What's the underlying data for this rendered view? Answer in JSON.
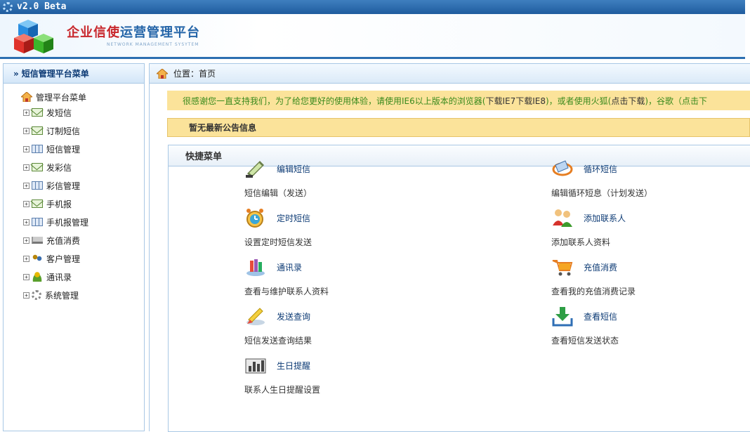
{
  "topbar": {
    "version": "v2.0 Beta"
  },
  "header": {
    "title_red": "企业信使",
    "title_blue": "运营管理平台",
    "subtitle": "NETWORK MANAGEMENT SYSYTEM"
  },
  "sidebar": {
    "heading": "短信管理平台菜单",
    "root": "管理平台菜单",
    "items": [
      {
        "label": "发短信",
        "icon": "mail-icon"
      },
      {
        "label": "订制短信",
        "icon": "mail-icon"
      },
      {
        "label": "短信管理",
        "icon": "table-icon"
      },
      {
        "label": "发彩信",
        "icon": "mail-icon"
      },
      {
        "label": "彩信管理",
        "icon": "table-icon"
      },
      {
        "label": "手机报",
        "icon": "mail-icon"
      },
      {
        "label": "手机报管理",
        "icon": "table-icon"
      },
      {
        "label": "充值消费",
        "icon": "cart-icon"
      },
      {
        "label": "客户管理",
        "icon": "users-icon"
      },
      {
        "label": "通讯录",
        "icon": "person-icon"
      },
      {
        "label": "系统管理",
        "icon": "gear-icon"
      }
    ]
  },
  "breadcrumb": {
    "text": "位置：首页"
  },
  "notice": {
    "lead": "很感谢您一直支持我们，为了给您更好的使用体验，请使用IE6以上版本的浏览器(",
    "dl1": "下载IE7",
    "sep": " ",
    "dl2": "下载IE8",
    "mid": ")，或者使用火狐(",
    "dl3": "点击下载",
    "tail": ")，谷歌（点击下"
  },
  "announcement": {
    "text": "暂无最新公告信息"
  },
  "quick_menu": {
    "title": "快捷菜单",
    "items": [
      {
        "title": "编辑短信",
        "desc": "短信编辑（发送）",
        "icon": "phone-icon"
      },
      {
        "title": "循环短信",
        "desc": "编辑循环短息（计划发送）",
        "icon": "loop-icon"
      },
      {
        "title": "定时短信",
        "desc": "设置定时短信发送",
        "icon": "alarm-clock-icon"
      },
      {
        "title": "添加联系人",
        "desc": "添加联系人资料",
        "icon": "add-contact-icon"
      },
      {
        "title": "通讯录",
        "desc": "查看与维护联系人资料",
        "icon": "address-book-icon"
      },
      {
        "title": "充值消费",
        "desc": "查看我的充值消费记录",
        "icon": "cart-icon"
      },
      {
        "title": "发送查询",
        "desc": "短信发送查询结果",
        "icon": "send-query-icon"
      },
      {
        "title": "查看短信",
        "desc": "查看短信发送状态",
        "icon": "download-icon"
      },
      {
        "title": "生日提醒",
        "desc": "联系人生日提醒设置",
        "icon": "birthday-chart-icon"
      }
    ]
  }
}
